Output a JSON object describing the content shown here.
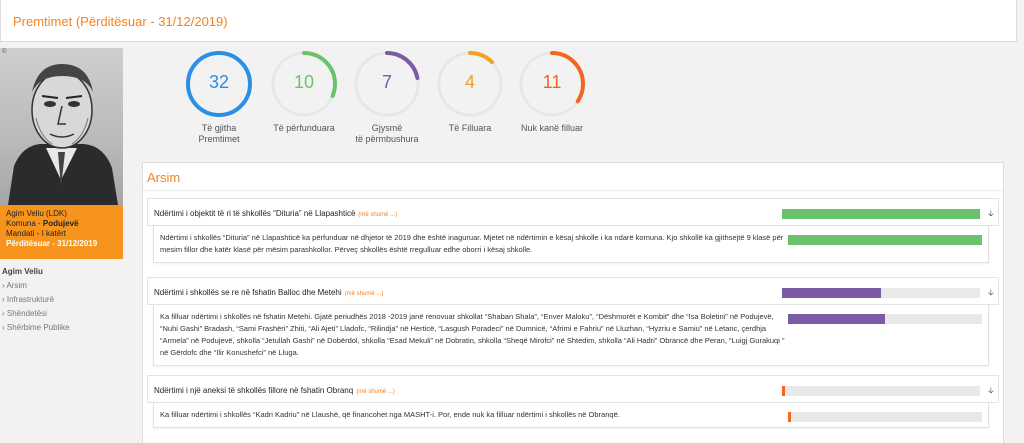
{
  "header": {
    "title": "Premtimet (Përditësuar - 31/12/2019)"
  },
  "profile": {
    "line1": "Agim Veliu (LDK)",
    "line2_label": "Komuna - ",
    "line2_value": "Podujevë",
    "line3": "Mandati - I katërt",
    "line4": "Përditësuar - 31/12/2019"
  },
  "nav": {
    "name": "Agim Veliu",
    "items": [
      "› Arsim",
      "› Infrastrukturë",
      "› Shëndetësi",
      "› Shërbime Publike"
    ]
  },
  "stats": [
    {
      "value": "32",
      "label1": "Të gjitha",
      "label2": "Premtimet",
      "color": "#2b8fe6",
      "fraction": 1.0
    },
    {
      "value": "10",
      "label1": "Të përfunduara",
      "label2": "",
      "color": "#6cc26c",
      "fraction": 0.3125
    },
    {
      "value": "7",
      "label1": "Gjysmë",
      "label2": "të përmbushura",
      "color": "#7b5aa6",
      "fraction": 0.21875
    },
    {
      "value": "4",
      "label1": "Të Filluara",
      "label2": "",
      "color": "#f5a023",
      "fraction": 0.125
    },
    {
      "value": "11",
      "label1": "Nuk kanë filluar",
      "label2": "",
      "color": "#f26522",
      "fraction": 0.34375
    }
  ],
  "section": {
    "title": "Arsim"
  },
  "more_label": "(më shumë ...)",
  "items": [
    {
      "title": "Ndërtimi i objektit të ri të shkollës “Dituria” në Llapashticë",
      "text": "Ndërtimi i shkollës “Dituria” në Llapashticë ka përfunduar në dhjetor të 2019 dhe është inaguruar. Mjetet në ndërtimin e kësaj shkolle i ka ndarë komuna. Kjo shkollë ka gjithsejtë 9 klasë për mesim fillor dhe katër klasë për mësim parashkollor. Përveç shkollës është rregulluar edhe oborri i kësaj shkolle.",
      "progress": 1.0,
      "color": "#6cc26c"
    },
    {
      "title": "Ndërtimi i shkollës se re në fshatin Balloc dhe Metehi",
      "text": "Ka filluar ndërtimi i shkollës në fshatin Metehi. Gjatë periudhës 2018 -2019 janë renovuar shkollat “Shaban Shala”, “Enver Maloku”, “Dëshmorët e Kombit” dhe “Isa Boletini” në Podujevë, “Nuhi Gashi” Bradash, “Sami Frashëri” Zhiti, “Ali Ajeti” Lladofc, “Rilindja” në Herticë, “Lasgush Poradeci” në Dumnicë, “Afrimi e Fahriu” në Lluzhan, “Hyzriu e Samiu” në Letanc, çerdhja “Armela” në Podujevë, shkolla “Jetullah Gashi” në Dobërdol, shkolla “Esad Mekuli” në Dobratin, shkolla “Sheqë Mirofci” në Shtedim, shkolla “Ali Hadri” Obrancë dhe Peran, “Luigj Gurakuqi ” në Gërdofc dhe “Ilir Konushefci” në Lluga.",
      "progress": 0.5,
      "color": "#7b5aa6"
    },
    {
      "title": "Ndërtimi i një aneksi të shkollës fillore në fshatin Obranq",
      "text": "Ka filluar ndërtimi i shkollës “Kadri Kadriu” në Llaushë, që financohet nga MASHT-i. Por, ende nuk ka filluar ndërtimi i shkollës në Obranqë.",
      "progress": 0.015,
      "color": "#f26522"
    }
  ]
}
